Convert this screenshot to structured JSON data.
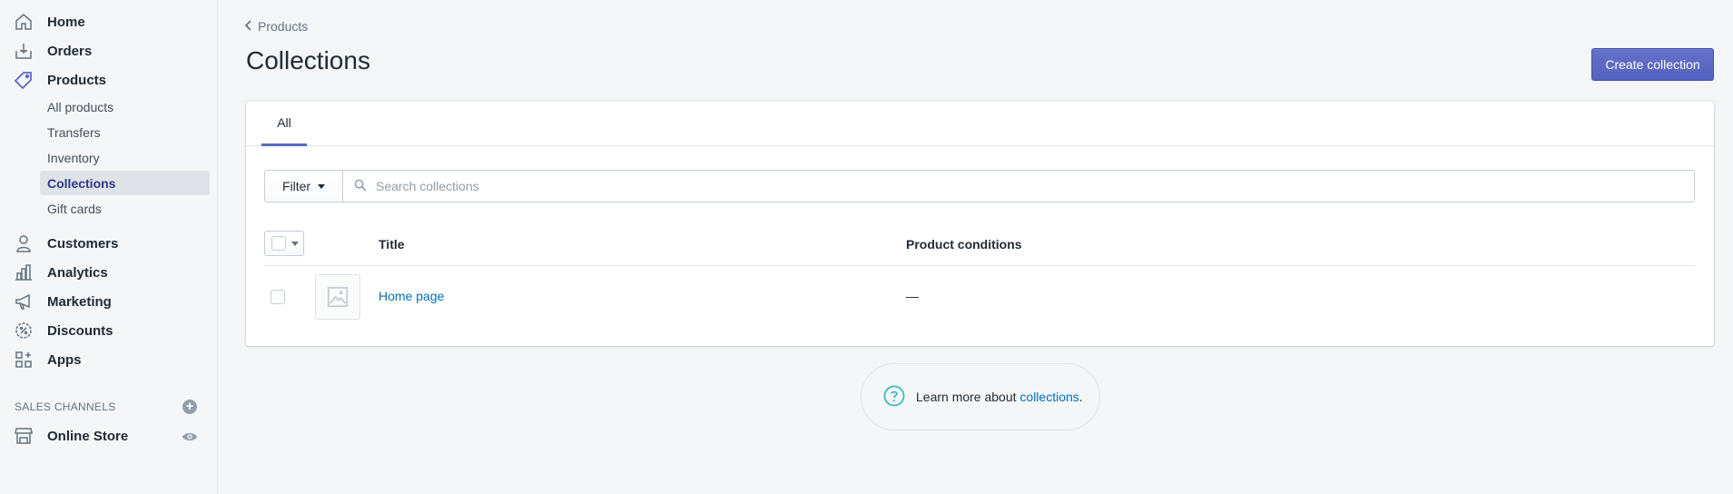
{
  "sidebar": {
    "items": [
      {
        "label": "Home",
        "icon": "home-icon"
      },
      {
        "label": "Orders",
        "icon": "orders-icon"
      },
      {
        "label": "Products",
        "icon": "tag-icon"
      },
      {
        "label": "Customers",
        "icon": "person-icon"
      },
      {
        "label": "Analytics",
        "icon": "bar-chart-icon"
      },
      {
        "label": "Marketing",
        "icon": "megaphone-icon"
      },
      {
        "label": "Discounts",
        "icon": "discount-icon"
      },
      {
        "label": "Apps",
        "icon": "apps-icon"
      }
    ],
    "product_sub_items": [
      "All products",
      "Transfers",
      "Inventory",
      "Collections",
      "Gift cards"
    ],
    "sales_channels_title": "SALES CHANNELS",
    "online_store": "Online Store"
  },
  "breadcrumb": "Products",
  "page_title": "Collections",
  "create_button": "Create collection",
  "tabs": [
    "All"
  ],
  "filter": {
    "button_label": "Filter",
    "search_placeholder": "Search collections"
  },
  "table": {
    "columns": [
      "Title",
      "Product conditions"
    ],
    "rows": [
      {
        "title": "Home page",
        "conditions": "—"
      }
    ]
  },
  "help": {
    "prefix": "Learn more about ",
    "link": "collections",
    "suffix": "."
  },
  "colors": {
    "accent": "#5c6ac4",
    "link": "#006fbb",
    "help_icon": "#47c1bf"
  }
}
